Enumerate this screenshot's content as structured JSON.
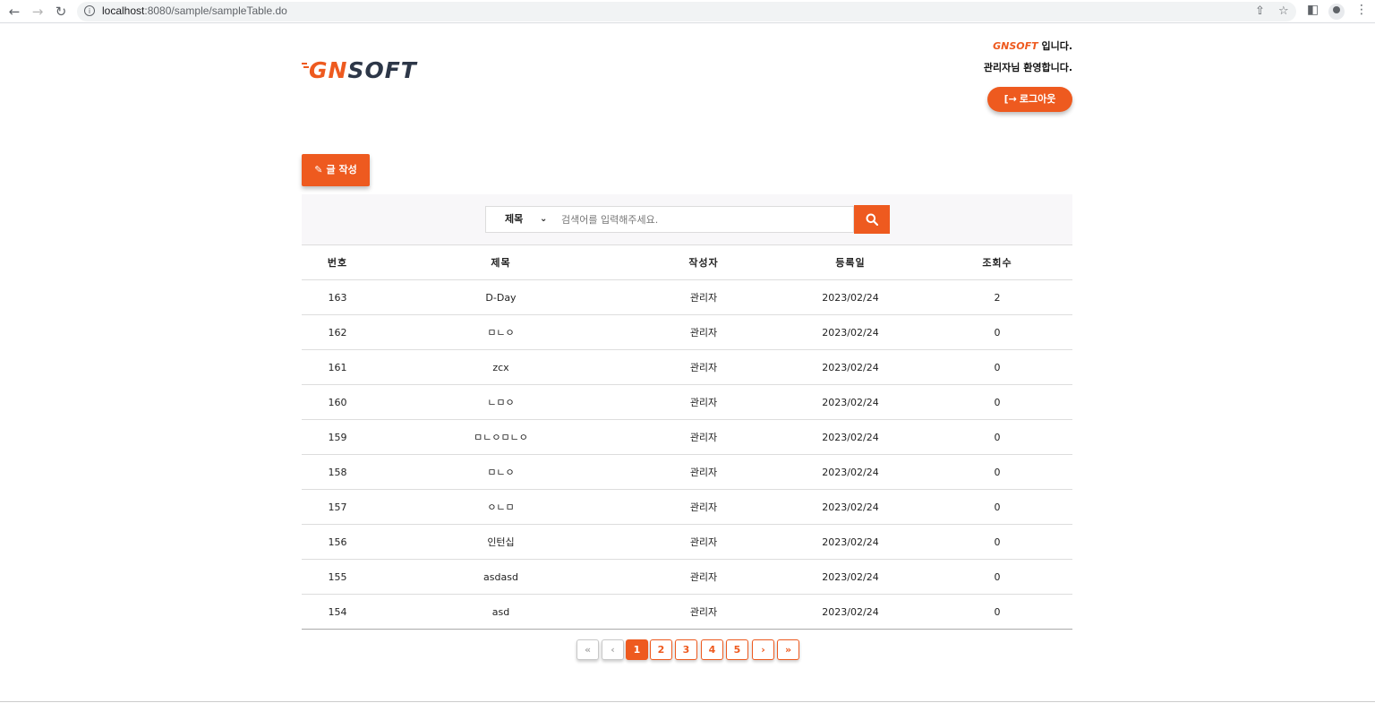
{
  "browser": {
    "url_host": "localhost",
    "url_rest": ":8080/sample/sampleTable.do"
  },
  "header": {
    "logo_gn": "GN",
    "logo_soft": "SOFT",
    "welcome_brand": "GNSOFT",
    "welcome_suffix": " 입니다.",
    "welcome_user": "관리자님 환영합니다.",
    "logout_label": "로그아웃"
  },
  "toolbar": {
    "write_label": "글 작성"
  },
  "search": {
    "selected_field": "제목",
    "placeholder": "검색어를 입력해주세요.",
    "value": ""
  },
  "table": {
    "headers": {
      "no": "번호",
      "title": "제목",
      "writer": "작성자",
      "date": "등록일",
      "views": "조회수"
    },
    "rows": [
      {
        "no": "163",
        "title": "D-Day",
        "writer": "관리자",
        "date": "2023/02/24",
        "views": "2"
      },
      {
        "no": "162",
        "title": "ㅁㄴㅇ",
        "writer": "관리자",
        "date": "2023/02/24",
        "views": "0"
      },
      {
        "no": "161",
        "title": "zcx",
        "writer": "관리자",
        "date": "2023/02/24",
        "views": "0"
      },
      {
        "no": "160",
        "title": "ㄴㅁㅇ",
        "writer": "관리자",
        "date": "2023/02/24",
        "views": "0"
      },
      {
        "no": "159",
        "title": "ㅁㄴㅇㅁㄴㅇ",
        "writer": "관리자",
        "date": "2023/02/24",
        "views": "0"
      },
      {
        "no": "158",
        "title": "ㅁㄴㅇ",
        "writer": "관리자",
        "date": "2023/02/24",
        "views": "0"
      },
      {
        "no": "157",
        "title": "ㅇㄴㅁ",
        "writer": "관리자",
        "date": "2023/02/24",
        "views": "0"
      },
      {
        "no": "156",
        "title": "인턴십",
        "writer": "관리자",
        "date": "2023/02/24",
        "views": "0"
      },
      {
        "no": "155",
        "title": "asdasd",
        "writer": "관리자",
        "date": "2023/02/24",
        "views": "0"
      },
      {
        "no": "154",
        "title": "asd",
        "writer": "관리자",
        "date": "2023/02/24",
        "views": "0"
      }
    ]
  },
  "pagination": {
    "first": "«",
    "prev": "‹",
    "pages": [
      "1",
      "2",
      "3",
      "4",
      "5"
    ],
    "current": "1",
    "next": "›",
    "last": "»"
  },
  "colors": {
    "accent": "#ee5a1f",
    "text": "#222222",
    "panel": "#f8f7f9"
  }
}
